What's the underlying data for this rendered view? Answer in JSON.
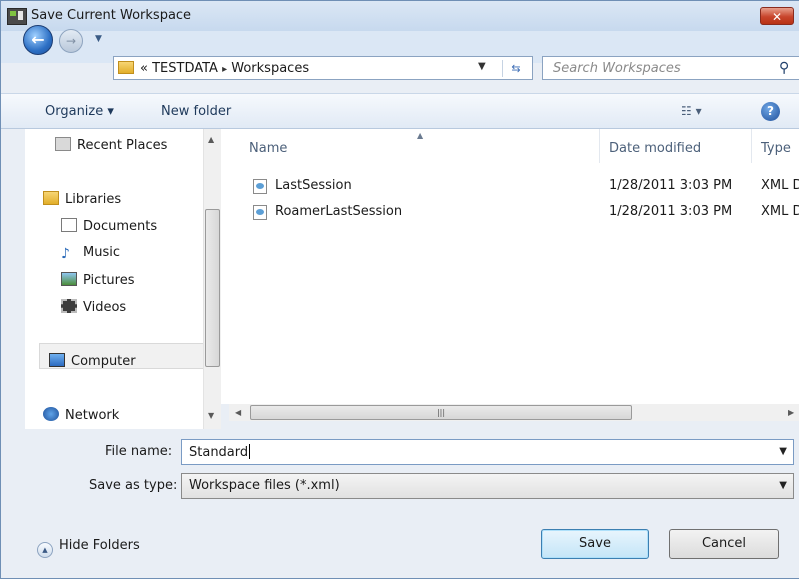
{
  "window": {
    "title": "Save Current Workspace",
    "close_label": "✕"
  },
  "address": {
    "crumb_prefix": "«",
    "crumbs": [
      "TESTDATA",
      "Workspaces"
    ],
    "crumb_sep": "▸",
    "search_placeholder": "Search Workspaces"
  },
  "toolbar": {
    "organize": "Organize ▾",
    "new_folder": "New folder",
    "views": "☷ ▾",
    "help": "?"
  },
  "nav": {
    "items": [
      {
        "label": "Recent Places",
        "icon": "recent-places-icon"
      },
      {
        "label": "Libraries",
        "icon": "libraries-icon"
      },
      {
        "label": "Documents",
        "icon": "documents-icon"
      },
      {
        "label": "Music",
        "icon": "music-icon"
      },
      {
        "label": "Pictures",
        "icon": "pictures-icon"
      },
      {
        "label": "Videos",
        "icon": "videos-icon"
      },
      {
        "label": "Computer",
        "icon": "computer-icon"
      },
      {
        "label": "Network",
        "icon": "network-icon"
      }
    ],
    "selected": "Computer"
  },
  "files": {
    "columns": {
      "name": "Name",
      "date": "Date modified",
      "type": "Type"
    },
    "rows": [
      {
        "name": "LastSession",
        "date": "1/28/2011 3:03 PM",
        "type": "XML D"
      },
      {
        "name": "RoamerLastSession",
        "date": "1/28/2011 3:03 PM",
        "type": "XML D"
      }
    ]
  },
  "form": {
    "file_name_label": "File name:",
    "file_name_value": "Standard",
    "save_type_label": "Save as type:",
    "save_type_value": "Workspace files (*.xml)"
  },
  "footer": {
    "hide_folders": "Hide Folders",
    "save": "Save",
    "cancel": "Cancel"
  },
  "colors": {
    "accent": "#3c7fb1",
    "window_bg": "#e9eef5",
    "close_red": "#c8452c"
  }
}
